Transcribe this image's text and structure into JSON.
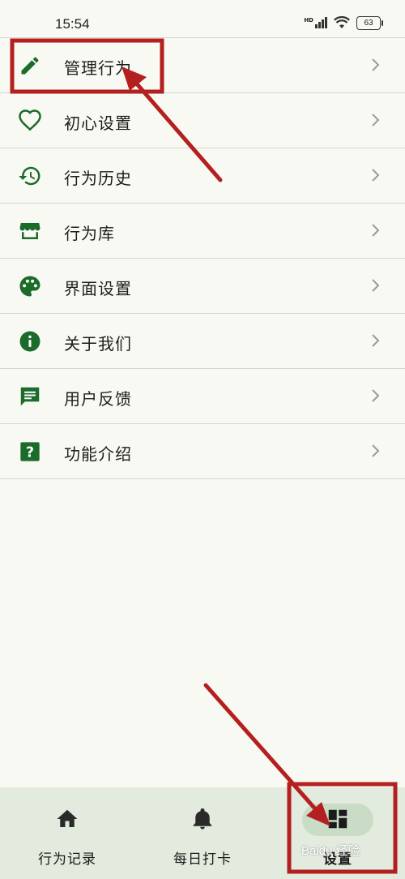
{
  "status_bar": {
    "time": "15:54",
    "network": "HD",
    "battery": "63"
  },
  "menu": [
    {
      "id": "manage",
      "label": "管理行为",
      "icon": "pencil-icon"
    },
    {
      "id": "intent",
      "label": "初心设置",
      "icon": "heart-icon"
    },
    {
      "id": "history",
      "label": "行为历史",
      "icon": "history-icon"
    },
    {
      "id": "library",
      "label": "行为库",
      "icon": "store-icon"
    },
    {
      "id": "ui",
      "label": "界面设置",
      "icon": "palette-icon"
    },
    {
      "id": "about",
      "label": "关于我们",
      "icon": "info-icon"
    },
    {
      "id": "feedback",
      "label": "用户反馈",
      "icon": "feedback-icon"
    },
    {
      "id": "intro",
      "label": "功能介绍",
      "icon": "help-icon"
    }
  ],
  "bottom_nav": [
    {
      "label": "行为记录",
      "icon": "home-icon"
    },
    {
      "label": "每日打卡",
      "icon": "bell-icon"
    },
    {
      "label": "设置",
      "icon": "dashboard-icon",
      "active": true
    }
  ],
  "watermark": "Baidu 经验",
  "colors": {
    "accent_green": "#1b6b2a",
    "annotation_red": "#b3201f",
    "nav_bg": "#e2ebdd"
  }
}
